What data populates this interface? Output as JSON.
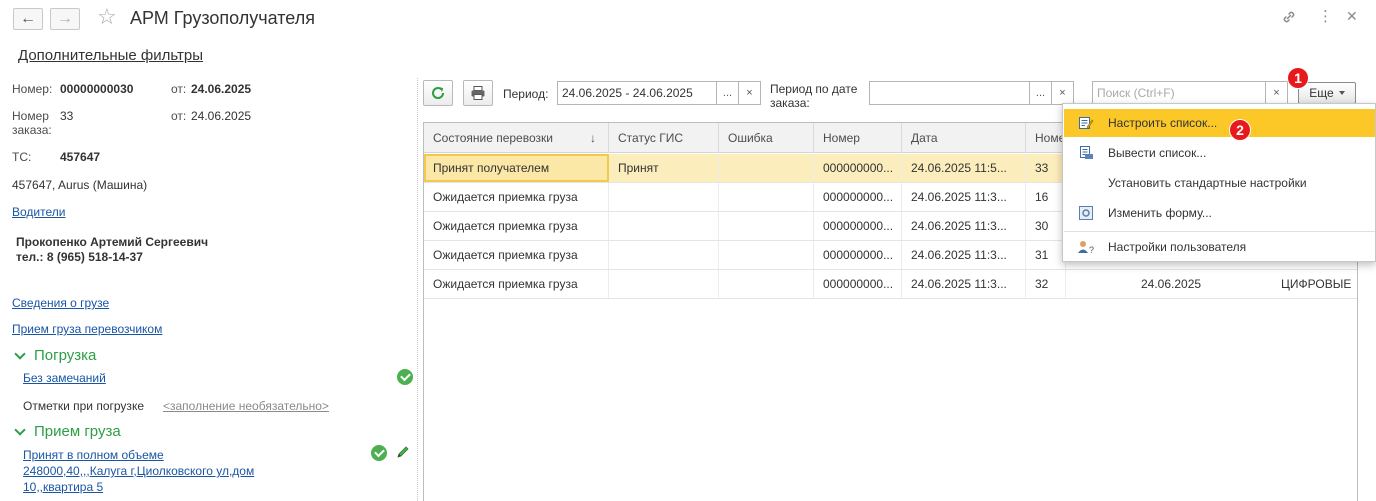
{
  "window": {
    "title": "АРМ Грузополучателя",
    "back_icon": "arrow-left-icon",
    "forward_icon": "arrow-right-icon",
    "favorite_icon": "star-icon",
    "link_icon": "link-icon",
    "more_icon": "vertical-dots-icon",
    "close_icon": "close-icon"
  },
  "left": {
    "filters_link": "Дополнительные фильтры",
    "number_label": "Номер:",
    "number_value": "00000000030",
    "from_label": "от:",
    "from_value": "24.06.2025",
    "order_label": "Номер заказа:",
    "order_value": "33",
    "order_from_label": "от:",
    "order_from_value": "24.06.2025",
    "ts_label": "ТС:",
    "ts_value": "457647",
    "vehicle": "457647, Aurus (Машина)",
    "drivers_link": "Водители",
    "driver_name": "Прокопенко Артемий Сергеевич",
    "driver_phone": "тел.: 8 (965) 518-14-37",
    "cargo_info_link": "Сведения о грузе",
    "carrier_receipt_link": "Прием груза перевозчиком",
    "loading": {
      "title": "Погрузка",
      "status_link": "Без замечаний",
      "notes_label": "Отметки при погрузке",
      "notes_placeholder": "<заполнение необязательно>"
    },
    "receipt": {
      "title": "Прием груза",
      "status_link_line1": "Принят в полном объеме",
      "status_link_line2": "248000,40,,,Калуга г,Циолковского ул,дом",
      "status_link_line3": "10,,квартира 5"
    }
  },
  "toolbar": {
    "refresh_icon": "refresh-icon",
    "print_icon": "printer-icon",
    "period_label": "Период:",
    "period_value": "24.06.2025 - 24.06.2025",
    "period_by_order_label": "Период по дате заказа:",
    "period_by_order_value": "",
    "select_btn": "...",
    "clear_btn": "×",
    "search_placeholder": "Поиск (Ctrl+F)",
    "more_button": "Еще"
  },
  "table": {
    "columns": [
      "Состояние перевозки",
      "Статус ГИС",
      "Ошибка",
      "Номер",
      "Дата",
      "Номе"
    ],
    "sort_indicator": "↓",
    "rows": [
      {
        "state": "Принят получателем",
        "gis": "Принят",
        "error": "",
        "number": "000000000...",
        "date": "24.06.2025 11:5...",
        "order": "33",
        "extra_date": "",
        "extra": ""
      },
      {
        "state": "Ожидается приемка груза",
        "gis": "",
        "error": "",
        "number": "000000000...",
        "date": "24.06.2025 11:3...",
        "order": "16",
        "extra_date": "",
        "extra": ""
      },
      {
        "state": "Ожидается приемка груза",
        "gis": "",
        "error": "",
        "number": "000000000...",
        "date": "24.06.2025 11:3...",
        "order": "30",
        "extra_date": "",
        "extra": ""
      },
      {
        "state": "Ожидается приемка груза",
        "gis": "",
        "error": "",
        "number": "000000000...",
        "date": "24.06.2025 11:3...",
        "order": "31",
        "extra_date": "",
        "extra": ""
      },
      {
        "state": "Ожидается приемка груза",
        "gis": "",
        "error": "",
        "number": "000000000...",
        "date": "24.06.2025 11:3...",
        "order": "32",
        "extra_date": "24.06.2025",
        "extra": "ЦИФРОВЫЕ"
      }
    ]
  },
  "menu": {
    "items": [
      {
        "label": "Настроить список...",
        "icon": "configure-list-icon"
      },
      {
        "label": "Вывести список...",
        "icon": "output-list-icon"
      },
      {
        "label": "Установить стандартные настройки",
        "icon": ""
      },
      {
        "label": "Изменить форму...",
        "icon": "change-form-icon"
      },
      {
        "label": "Настройки пользователя",
        "icon": "user-settings-icon"
      }
    ]
  },
  "annotations": {
    "badge1": "1",
    "badge2": "2"
  },
  "colors": {
    "accent_green": "#2c9f45",
    "link_blue": "#1a55a5",
    "selection": "#fbedbc",
    "menu_highlight": "#fbc827",
    "badge_red": "#e8191c"
  }
}
